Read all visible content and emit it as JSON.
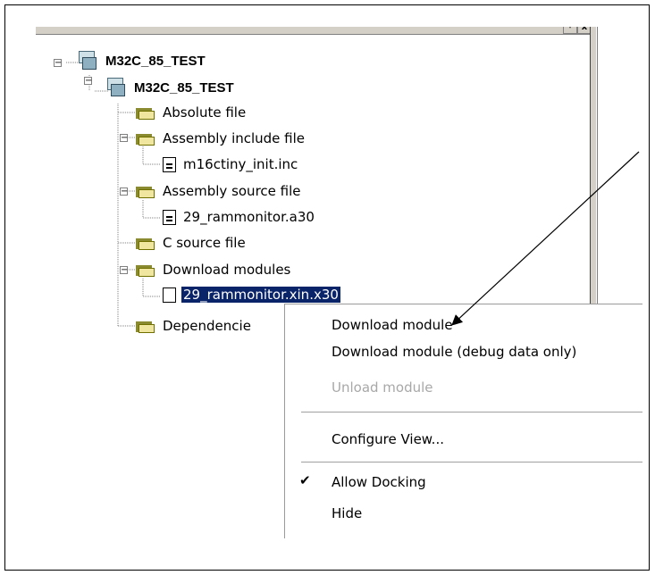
{
  "window": {
    "minimize_glyph": "▾",
    "close_glyph": "x"
  },
  "tree": {
    "root": {
      "label": "M32C_85_TEST",
      "expander": "−"
    },
    "project": {
      "label": "M32C_85_TEST",
      "expander": "−"
    },
    "nodes": [
      {
        "label": "Absolute file"
      },
      {
        "label": "Assembly include file",
        "expander": "−"
      },
      {
        "label": "m16ctiny_init.inc"
      },
      {
        "label": "Assembly source file",
        "expander": "−"
      },
      {
        "label": "29_rammonitor.a30"
      },
      {
        "label": "C source file"
      },
      {
        "label": "Download modules",
        "expander": "−"
      },
      {
        "label": "29_rammonitor.xin.x30"
      },
      {
        "label": "Dependencie"
      }
    ]
  },
  "context_menu": {
    "items": [
      {
        "label": "Download module",
        "enabled": true
      },
      {
        "label": "Download module (debug data only)",
        "enabled": true
      },
      {
        "label": "Unload module",
        "enabled": false
      },
      {
        "label": "Configure View...",
        "enabled": true
      },
      {
        "label": "Allow Docking",
        "enabled": true,
        "checked": true
      },
      {
        "label": "Hide",
        "enabled": true
      }
    ],
    "check_glyph": "✔"
  },
  "colors": {
    "selection": "#0a246a",
    "folder": "#f0e6a0",
    "disabled": "#a8a8a8"
  }
}
